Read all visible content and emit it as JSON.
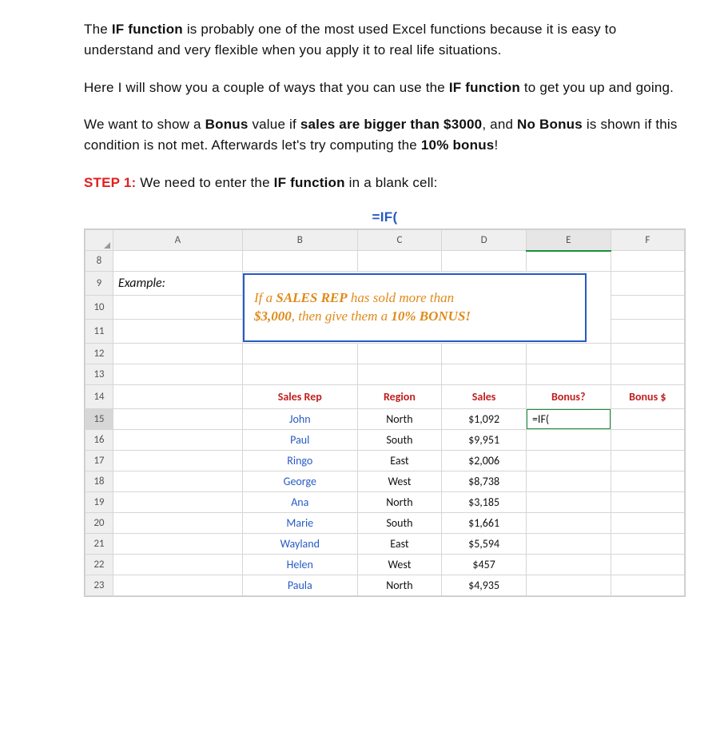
{
  "prose": {
    "p1_a": "The ",
    "p1_b": "IF function",
    "p1_c": " is probably one of the most used Excel functions because it is easy to understand and very flexible when you apply it to real life situations.",
    "p2_a": "Here I will show you a couple of ways that you can use the ",
    "p2_b": "IF function",
    "p2_c": " to get you up and going.",
    "p3_a": "We want to show a ",
    "p3_b": "Bonus",
    "p3_c": " value if ",
    "p3_d": "sales are bigger than $3000",
    "p3_e": ", and ",
    "p3_f": "No Bonus",
    "p3_g": " is shown if this condition is not met. Afterwards let's try computing the ",
    "p3_h": "10% bonus",
    "p3_i": "!",
    "step_label": "STEP 1:",
    "p4_a": "  We need to enter the ",
    "p4_b": "IF function",
    "p4_c": " in a blank cell:"
  },
  "formula_heading": "=IF(",
  "sheet": {
    "columns": [
      "A",
      "B",
      "C",
      "D",
      "E",
      "F"
    ],
    "first_row": "8",
    "example_label": "Example:",
    "callout_l1_a": "If a ",
    "callout_l1_b": "SALES REP",
    "callout_l1_c": " has sold more than",
    "callout_l2_a": "$3,000",
    "callout_l2_b": ", then give them a ",
    "callout_l2_c": "10% BONUS!",
    "row_nums": [
      "9",
      "10",
      "11",
      "12",
      "13",
      "14",
      "15",
      "16",
      "17",
      "18",
      "19",
      "20",
      "21",
      "22",
      "23"
    ],
    "headers": {
      "rep": "Sales Rep",
      "region": "Region",
      "sales": "Sales",
      "bonusq": "Bonus?",
      "bonusd": "Bonus $"
    },
    "active_formula": "=IF(",
    "rows": [
      {
        "n": "15",
        "rep": "John",
        "region": "North",
        "sales": "$1,092"
      },
      {
        "n": "16",
        "rep": "Paul",
        "region": "South",
        "sales": "$9,951"
      },
      {
        "n": "17",
        "rep": "Ringo",
        "region": "East",
        "sales": "$2,006"
      },
      {
        "n": "18",
        "rep": "George",
        "region": "West",
        "sales": "$8,738"
      },
      {
        "n": "19",
        "rep": "Ana",
        "region": "North",
        "sales": "$3,185"
      },
      {
        "n": "20",
        "rep": "Marie",
        "region": "South",
        "sales": "$1,661"
      },
      {
        "n": "21",
        "rep": "Wayland",
        "region": "East",
        "sales": "$5,594"
      },
      {
        "n": "22",
        "rep": "Helen",
        "region": "West",
        "sales": "$457"
      },
      {
        "n": "23",
        "rep": "Paula",
        "region": "North",
        "sales": "$4,935"
      }
    ]
  },
  "chart_data": {
    "type": "table",
    "title": "Sales Rep bonus example data",
    "columns": [
      "Sales Rep",
      "Region",
      "Sales"
    ],
    "rows": [
      [
        "John",
        "North",
        1092
      ],
      [
        "Paul",
        "South",
        9951
      ],
      [
        "Ringo",
        "East",
        2006
      ],
      [
        "George",
        "West",
        8738
      ],
      [
        "Ana",
        "North",
        3185
      ],
      [
        "Marie",
        "South",
        1661
      ],
      [
        "Wayland",
        "East",
        5594
      ],
      [
        "Helen",
        "West",
        457
      ],
      [
        "Paula",
        "North",
        4935
      ]
    ],
    "condition": "Bonus if Sales > 3000; bonus amount = 10% of Sales"
  }
}
